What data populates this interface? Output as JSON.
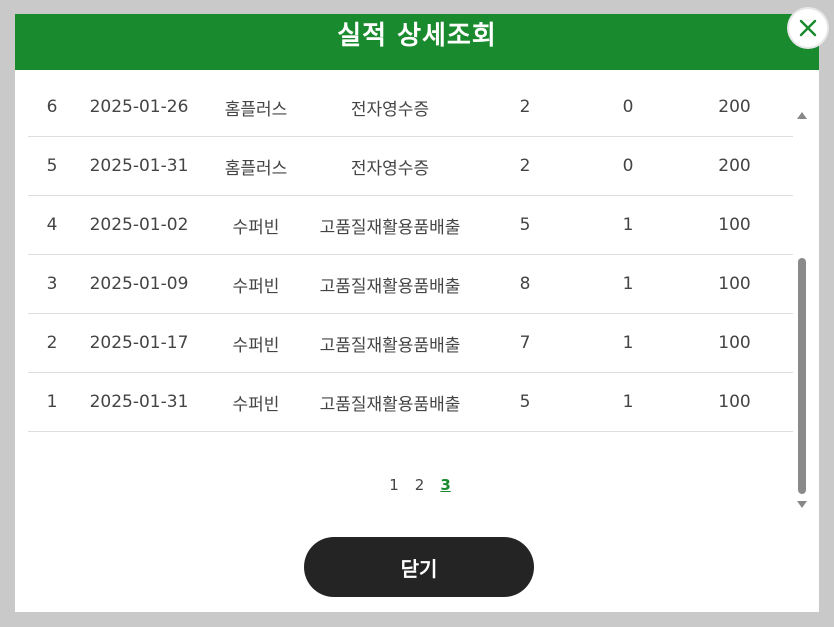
{
  "header": {
    "title": "실적 상세조회"
  },
  "rows": [
    [
      "6",
      "2025-01-26",
      "홈플러스",
      "전자영수증",
      "2",
      "0",
      "200"
    ],
    [
      "5",
      "2025-01-31",
      "홈플러스",
      "전자영수증",
      "2",
      "0",
      "200"
    ],
    [
      "4",
      "2025-01-02",
      "수퍼빈",
      "고품질재활용품배출",
      "5",
      "1",
      "100"
    ],
    [
      "3",
      "2025-01-09",
      "수퍼빈",
      "고품질재활용품배출",
      "8",
      "1",
      "100"
    ],
    [
      "2",
      "2025-01-17",
      "수퍼빈",
      "고품질재활용품배출",
      "7",
      "1",
      "100"
    ],
    [
      "1",
      "2025-01-31",
      "수퍼빈",
      "고품질재활용품배출",
      "5",
      "1",
      "100"
    ]
  ],
  "pagination": {
    "pages": [
      "1",
      "2",
      "3"
    ],
    "current": "3"
  },
  "footer": {
    "close_label": "닫기"
  },
  "colors": {
    "accent": "#1a8a2e",
    "button": "#242424"
  },
  "icons": {
    "close": "close-icon"
  }
}
